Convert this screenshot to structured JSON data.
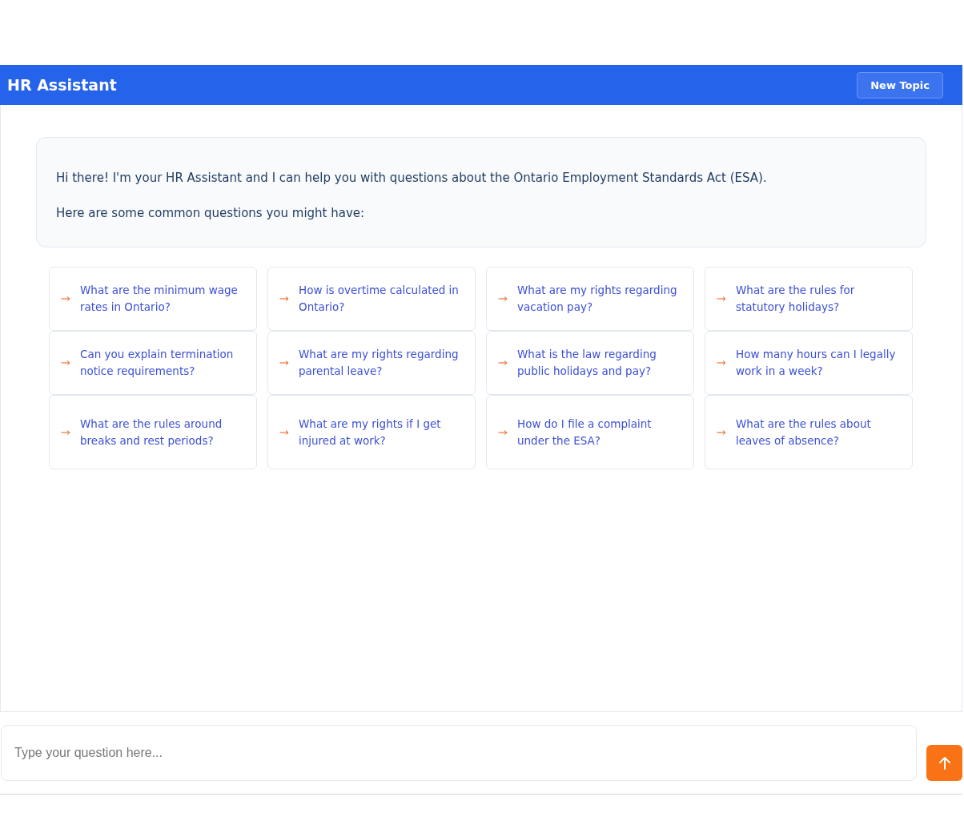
{
  "header": {
    "title": "HR Assistant",
    "new_topic_button": "New Topic"
  },
  "welcome": {
    "paragraphs": [
      "Hi there! I'm your HR Assistant and I can help you with questions about the Ontario Employment Standards Act (ESA).",
      "Here are some common questions you might have:"
    ]
  },
  "suggestions": [
    {
      "text": "What are the minimum wage rates in Ontario?"
    },
    {
      "text": "How is overtime calculated in Ontario?"
    },
    {
      "text": "What are my rights regarding vacation pay?"
    },
    {
      "text": "What are the rules for statutory holidays?"
    },
    {
      "text": "Can you explain termination notice requirements?"
    },
    {
      "text": "What are my rights regarding parental leave?"
    },
    {
      "text": "What is the law regarding public holidays and pay?"
    },
    {
      "text": "How many hours can I legally work in a week?"
    },
    {
      "text": "What are the rules around breaks and rest periods?"
    },
    {
      "text": "What are my rights if I get injured at work?"
    },
    {
      "text": "How do I file a complaint under the ESA?"
    },
    {
      "text": "What are the rules about leaves of absence?"
    }
  ],
  "composer": {
    "placeholder": "Type your question here..."
  }
}
